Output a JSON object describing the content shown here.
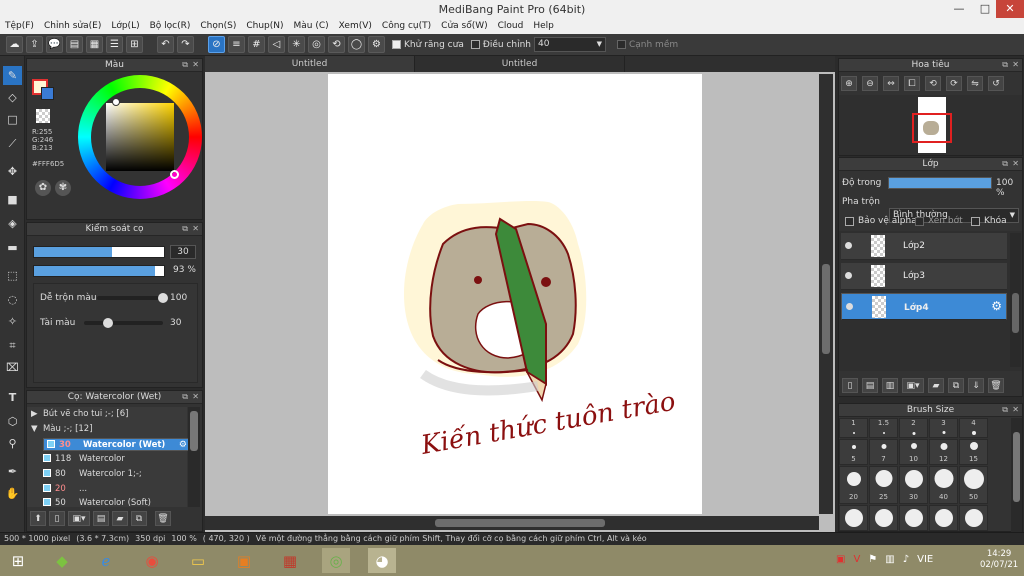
{
  "window": {
    "title": "MediBang Paint Pro (64bit)",
    "minimize": "—",
    "maximize": "□",
    "close": "✕"
  },
  "menu": [
    "Tệp(F)",
    "Chỉnh sửa(E)",
    "Lớp(L)",
    "Bộ lọc(R)",
    "Chọn(S)",
    "Chup(N)",
    "Màu (C)",
    "Xem(V)",
    "Công cụ(T)",
    "Cửa sổ(W)",
    "Cloud",
    "Help"
  ],
  "toolbar": {
    "antialias_label": "Khử răng cưa",
    "correction_label": "Điều chỉnh",
    "correction_value": "40",
    "soft_edge_label": "Cạnh mềm"
  },
  "color_panel": {
    "title": "Màu",
    "r": "R:255",
    "g": "G:246",
    "b": "B:213",
    "hex": "#FFF6D5",
    "primary_color": "#FFF6D5",
    "secondary_color": "#3a7bd5"
  },
  "brush_control": {
    "title": "Kiểm soát cọ",
    "size": "30",
    "size_fraction": 0.6,
    "opacity": "93 %",
    "opacity_fraction": 0.93,
    "blend_label": "Dễ trộn màu",
    "blend_value": "100",
    "blend_fraction": 1.0,
    "amount_label": "Tài màu",
    "amount_value": "30",
    "amount_fraction": 0.3
  },
  "brush_list": {
    "title": "Cọ: Watercolor (Wet)",
    "groups": [
      {
        "arrow": "▶",
        "label": "Bút vẽ cho tui ;-; [6]"
      },
      {
        "arrow": "▼",
        "label": "Màu ;-; [12]"
      }
    ],
    "items": [
      {
        "size": "30",
        "name": "Watercolor (Wet)",
        "selected": true
      },
      {
        "size": "118",
        "name": "Watercolor",
        "selected": false
      },
      {
        "size": "80",
        "name": "Watercolor 1;-;",
        "selected": false
      },
      {
        "size": "20",
        "name": "...",
        "selected": false
      },
      {
        "size": "50",
        "name": "Watercolor (Soft)",
        "selected": false
      }
    ]
  },
  "tabs": [
    "Untitled",
    "Untitled"
  ],
  "artwork_text": "Kiến thức tuôn trào",
  "navigator": {
    "title": "Hoa tiêu"
  },
  "layers": {
    "title": "Lớp",
    "opacity_label": "Độ trong",
    "opacity_value": "100 %",
    "opacity_fraction": 1.0,
    "blend_label": "Pha trộn",
    "blend_value": "Bình thường",
    "protect_alpha": "Bảo vệ alpha",
    "clipping": "Xén bớt",
    "lock": "Khóa",
    "items": [
      {
        "name": "Lớp2",
        "selected": false
      },
      {
        "name": "Lớp3",
        "selected": false
      },
      {
        "name": "Lớp4",
        "selected": true
      }
    ]
  },
  "brush_size": {
    "title": "Brush Size",
    "sizes": [
      "1",
      "1.5",
      "2",
      "3",
      "4",
      "5",
      "7",
      "10",
      "12",
      "15",
      "20",
      "25",
      "30",
      "40",
      "50"
    ]
  },
  "status": {
    "size": "500 * 1000 pixel",
    "physical": "(3.6 * 7.3cm)",
    "dpi": "350 dpi",
    "zoom": "100 %",
    "coords": "( 470, 320 )",
    "hint": "Vẽ một đường thẳng bằng cách giữ phím Shift, Thay đổi cỡ cọ bằng cách giữ phím Ctrl, Alt và kéo"
  },
  "taskbar": {
    "language": "VIE",
    "time": "14:29",
    "date": "02/07/21"
  }
}
